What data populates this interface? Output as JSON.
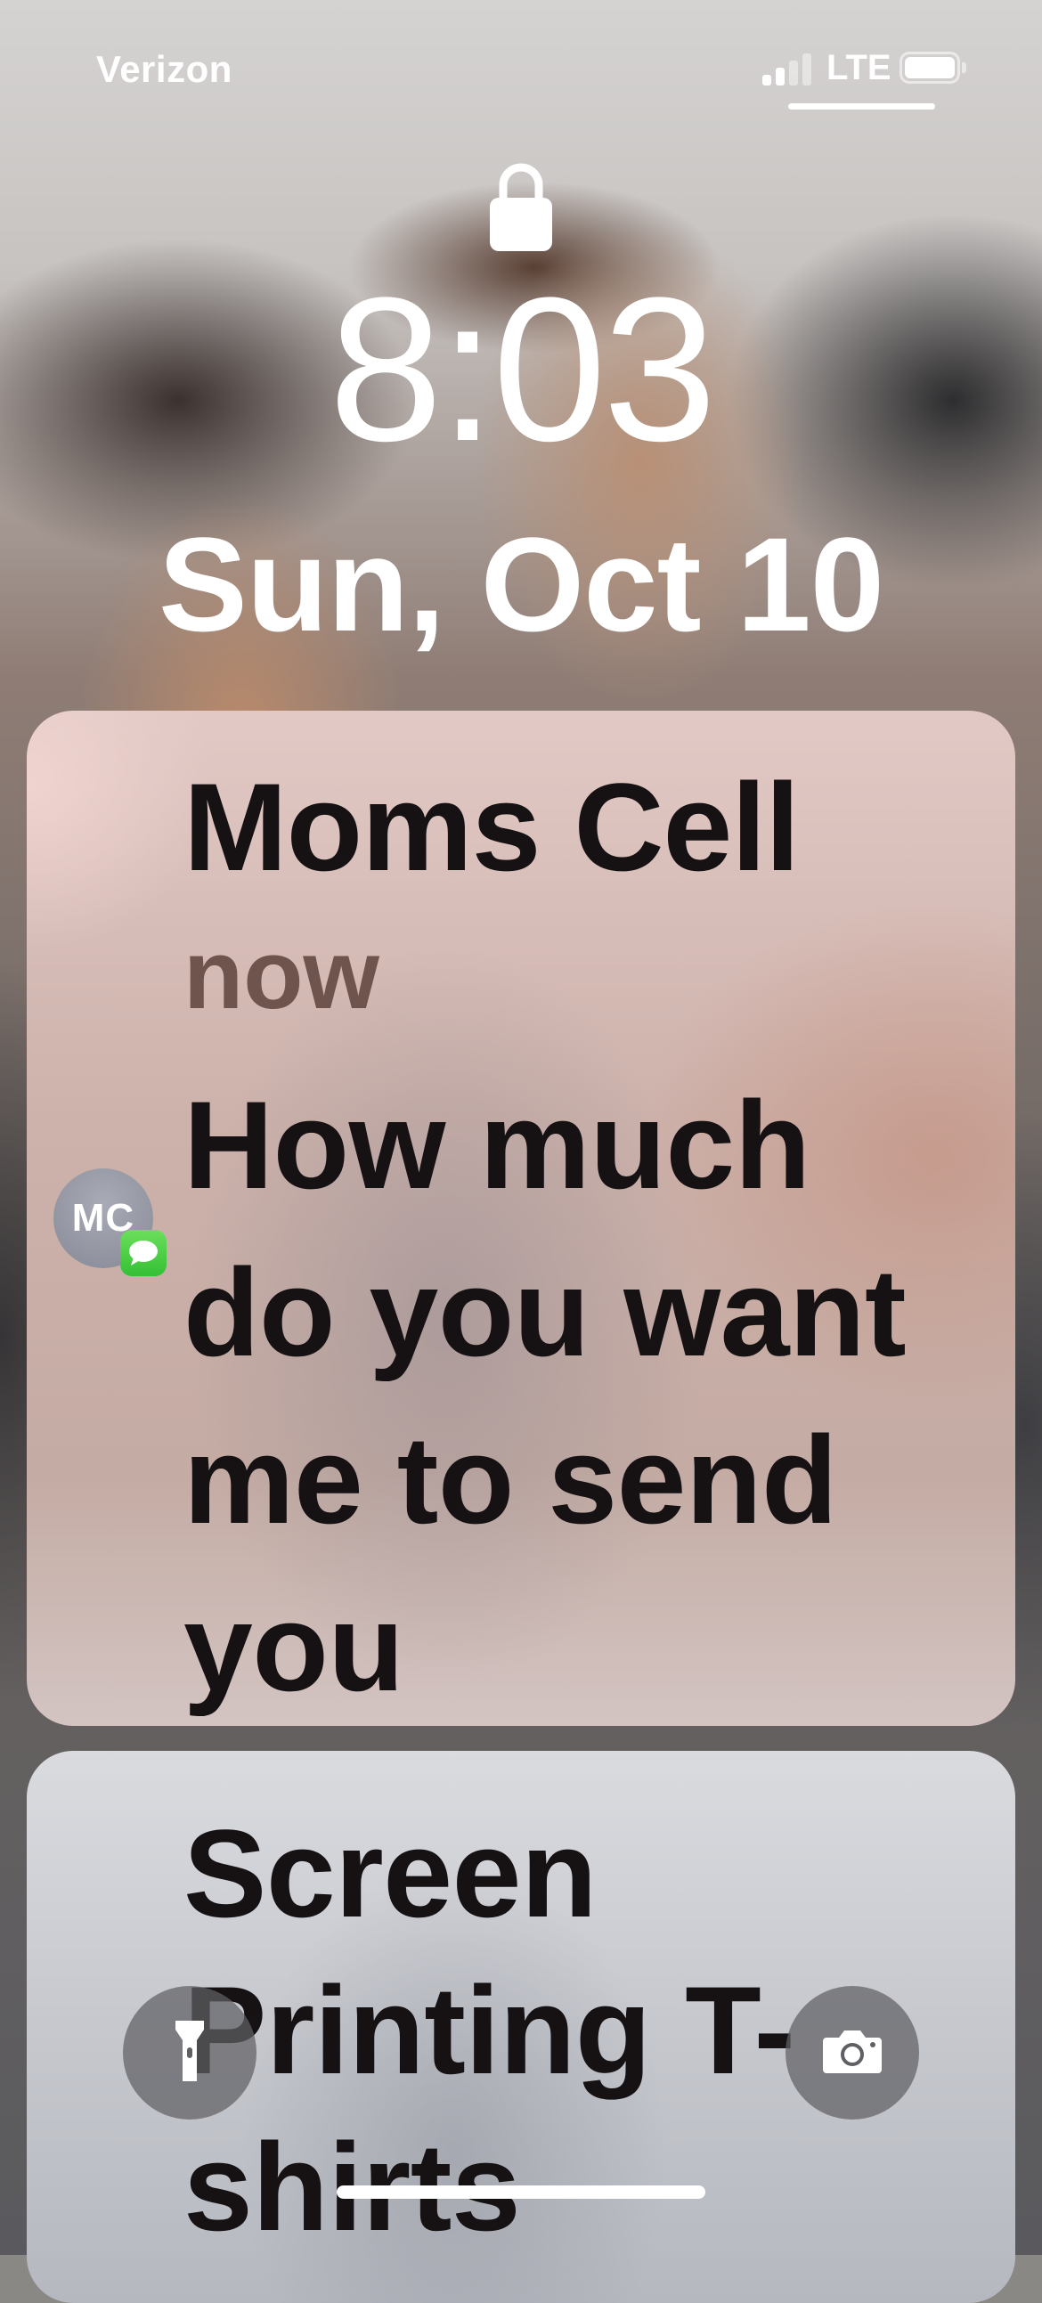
{
  "status_bar": {
    "carrier": "Verizon",
    "network": "LTE",
    "signal_bars_filled": 2,
    "signal_bars_total": 4,
    "battery_level": 1.0,
    "icons": [
      "cellular-signal-icon",
      "battery-icon"
    ]
  },
  "lock_screen": {
    "lock_icon": "lock-icon",
    "time": "8:03",
    "date": "Sun, Oct 10"
  },
  "notifications": [
    {
      "sender": "Moms Cell",
      "timestamp": "now",
      "message_lines": [
        "How much",
        "do you want",
        "me to send",
        "you"
      ],
      "avatar_initials": "MC",
      "app_icon": "messages-app-icon"
    },
    {
      "title_lines": [
        "Screen",
        "Printing T-",
        "shirts"
      ]
    }
  ],
  "controls": {
    "flashlight_icon": "flashlight-icon",
    "camera_icon": "camera-icon"
  },
  "colors": {
    "messages_green": "#34C036",
    "notification_text": "#161214",
    "timestamp_text": "#6E544D"
  }
}
